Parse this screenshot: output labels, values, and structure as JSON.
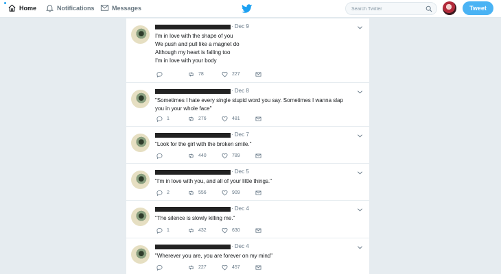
{
  "nav": {
    "home_label": "Home",
    "notifications_label": "Notifications",
    "messages_label": "Messages"
  },
  "search": {
    "placeholder": "Search Twitter"
  },
  "tweet_button_label": "Tweet",
  "colors": {
    "accent": "#1da1f2",
    "button": "#4ab3f4",
    "background": "#e6ecf0"
  },
  "tweets": [
    {
      "date": "Dec 9",
      "lines": [
        "I'm in love with the shape of you",
        "We push and pull like a magnet do",
        "Although my heart is falling too",
        "I'm in love with your body"
      ],
      "replies": "",
      "retweets": "78",
      "likes": "227"
    },
    {
      "date": "Dec 8",
      "lines": [
        "\"Sometimes I hate every single stupid word you say. Sometimes I wanna slap",
        "you in your whole face\""
      ],
      "replies": "1",
      "retweets": "276",
      "likes": "481"
    },
    {
      "date": "Dec 7",
      "lines": [
        "\"Look for the girl with the broken smile.\""
      ],
      "replies": "",
      "retweets": "440",
      "likes": "789"
    },
    {
      "date": "Dec 5",
      "lines": [
        "\"I'm in love with you, and all of your little things.\""
      ],
      "replies": "2",
      "retweets": "556",
      "likes": "909"
    },
    {
      "date": "Dec 4",
      "lines": [
        "\"The silence is slowly killing me.\""
      ],
      "replies": "1",
      "retweets": "432",
      "likes": "630"
    },
    {
      "date": "Dec 4",
      "lines": [
        "\"Wherever you are, you are forever on my mind\""
      ],
      "replies": "",
      "retweets": "227",
      "likes": "457"
    }
  ]
}
